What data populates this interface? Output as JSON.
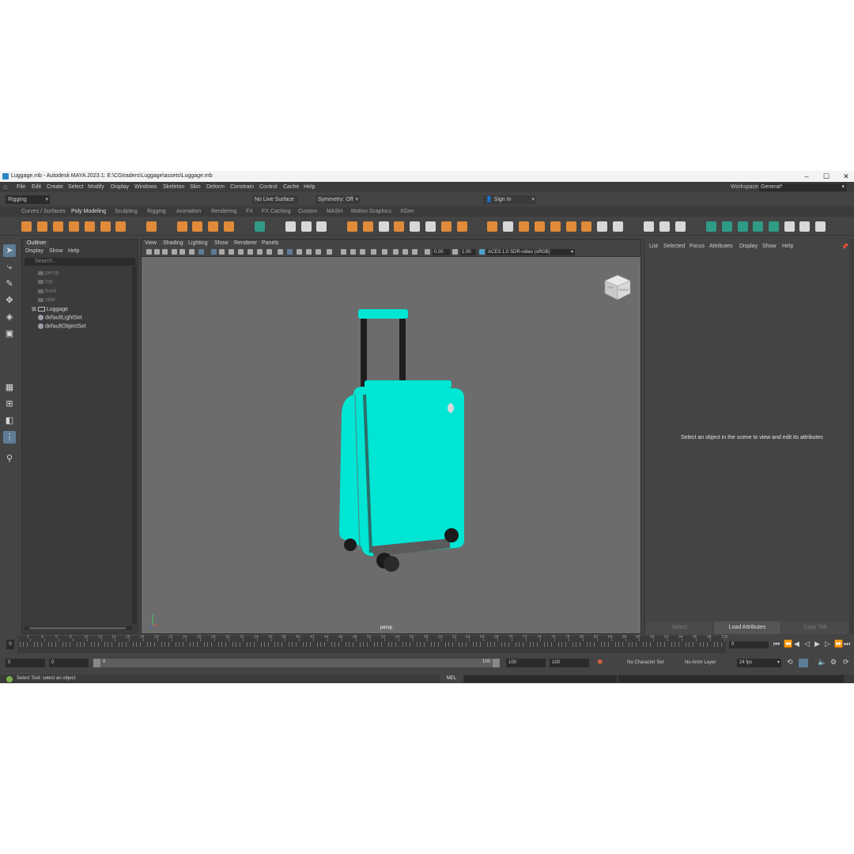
{
  "window": {
    "title": "Luggage.mb - Autodesk MAYA 2023.1: E:\\CGtraders\\Luggage\\assets\\Luggage.mb",
    "controls": [
      "–",
      "☐",
      "✕"
    ]
  },
  "menubar": {
    "items": [
      "File",
      "Edit",
      "Create",
      "Select",
      "Modify",
      "Display",
      "Windows",
      "Skeleton",
      "Skin",
      "Deform",
      "Constrain",
      "Control",
      "Cache",
      "Help"
    ],
    "workspace_label": "Workspace:",
    "workspace_value": "General*"
  },
  "statusline": {
    "mode": "Rigging",
    "live_surface": "No Live Surface",
    "symmetry": "Symmetry: Off",
    "sign_in": "Sign In"
  },
  "shelf": {
    "tabs": [
      "Curves / Surfaces",
      "Poly Modeling",
      "Sculpting",
      "Rigging",
      "Animation",
      "Rendering",
      "FX",
      "FX Caching",
      "Custom",
      "MASH",
      "Motion Graphics",
      "XGen"
    ],
    "active_tab": "Poly Modeling"
  },
  "outliner": {
    "tab": "Outliner",
    "menu": [
      "Display",
      "Show",
      "Help"
    ],
    "search_placeholder": "Search...",
    "items": [
      {
        "label": "persp",
        "kind": "camera"
      },
      {
        "label": "top",
        "kind": "camera"
      },
      {
        "label": "front",
        "kind": "camera"
      },
      {
        "label": "side",
        "kind": "camera"
      },
      {
        "label": "Luggage",
        "kind": "group"
      },
      {
        "label": "defaultLightSet",
        "kind": "set"
      },
      {
        "label": "defaultObjectSet",
        "kind": "set"
      }
    ]
  },
  "viewport": {
    "menu": [
      "View",
      "Shading",
      "Lighting",
      "Show",
      "Renderer",
      "Panels"
    ],
    "field_a": "0.00",
    "field_b": "1.00",
    "colorspace": "ACES 1.0 SDR-video (sRGB)",
    "camera_label": "persp",
    "cube_top": "TOP",
    "cube_front": "FRONT",
    "model_color": "#00e5d4"
  },
  "attribute_editor": {
    "menu": [
      "List",
      "Selected",
      "Focus",
      "Attributes",
      "Display",
      "Show",
      "Help"
    ],
    "hint": "Select an object in the scene to view and edit its attributes",
    "buttons": [
      "Select",
      "Load Attributes",
      "Copy Tab"
    ]
  },
  "timeline": {
    "current": "0",
    "ticks": [
      "2",
      "4",
      "6",
      "8",
      "10",
      "12",
      "14",
      "16",
      "18",
      "20",
      "22",
      "24",
      "26",
      "28",
      "30",
      "32",
      "34",
      "36",
      "38",
      "40",
      "42",
      "44",
      "46",
      "48",
      "50",
      "52",
      "54",
      "56",
      "58",
      "60",
      "62",
      "64",
      "66",
      "68",
      "70",
      "72",
      "74",
      "76",
      "78",
      "80",
      "82",
      "84",
      "86",
      "88",
      "90",
      "92",
      "94",
      "96",
      "98",
      "100"
    ],
    "frame_field": "0"
  },
  "range": {
    "start": "0",
    "anim_start": "0",
    "slider_start": "0",
    "slider_end": "100",
    "end": "100",
    "anim_end": "100",
    "character_set": "No Character Set",
    "anim_layer": "No Anim Layer",
    "fps": "24 fps"
  },
  "helpline": {
    "text": "Select Tool: select an object",
    "mel": "MEL"
  }
}
